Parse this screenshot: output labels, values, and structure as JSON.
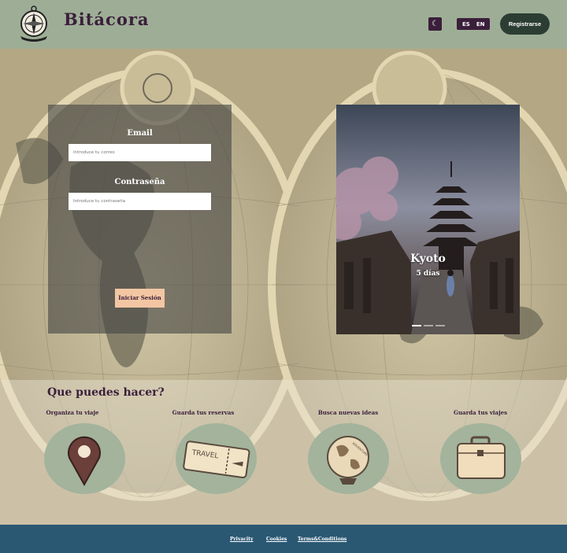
{
  "header": {
    "brand": "Bitácora",
    "theme_toggle_glyph": "☾",
    "languages": [
      "ES",
      "EN"
    ],
    "register_label": "Registrarse"
  },
  "login": {
    "email_label": "Email",
    "email_placeholder": "Introduce tu correo",
    "password_label": "Contraseña",
    "password_placeholder": "Introduce tu contraseña",
    "submit_label": "Iniciar Sesión"
  },
  "carousel": {
    "title": "Kyoto",
    "subtitle": "5 días",
    "slide_count": 3,
    "active_slide": 1
  },
  "features": {
    "title": "Que puedes hacer?",
    "items": [
      {
        "label": "Organiza tu viaje",
        "icon": "location-pin-icon"
      },
      {
        "label": "Guarda tus reservas",
        "icon": "travel-ticket-icon"
      },
      {
        "label": "Busca nuevas ideas",
        "icon": "globe-adventure-icon"
      },
      {
        "label": "Guarda tus viajes",
        "icon": "suitcase-icon"
      }
    ],
    "ticket_text": "TRAVEL",
    "globe_text": "ADVENTURE"
  },
  "footer": {
    "links": [
      "Privacity",
      "Cookies",
      "Terms&Conditions"
    ]
  },
  "colors": {
    "header_bg": "#9eae96",
    "brand_text": "#3a1f3b",
    "button_dark": "#2c3d34",
    "login_button": "#f3c6a3",
    "feature_circle": "#a3b39c",
    "footer_bg": "#2a5873"
  }
}
